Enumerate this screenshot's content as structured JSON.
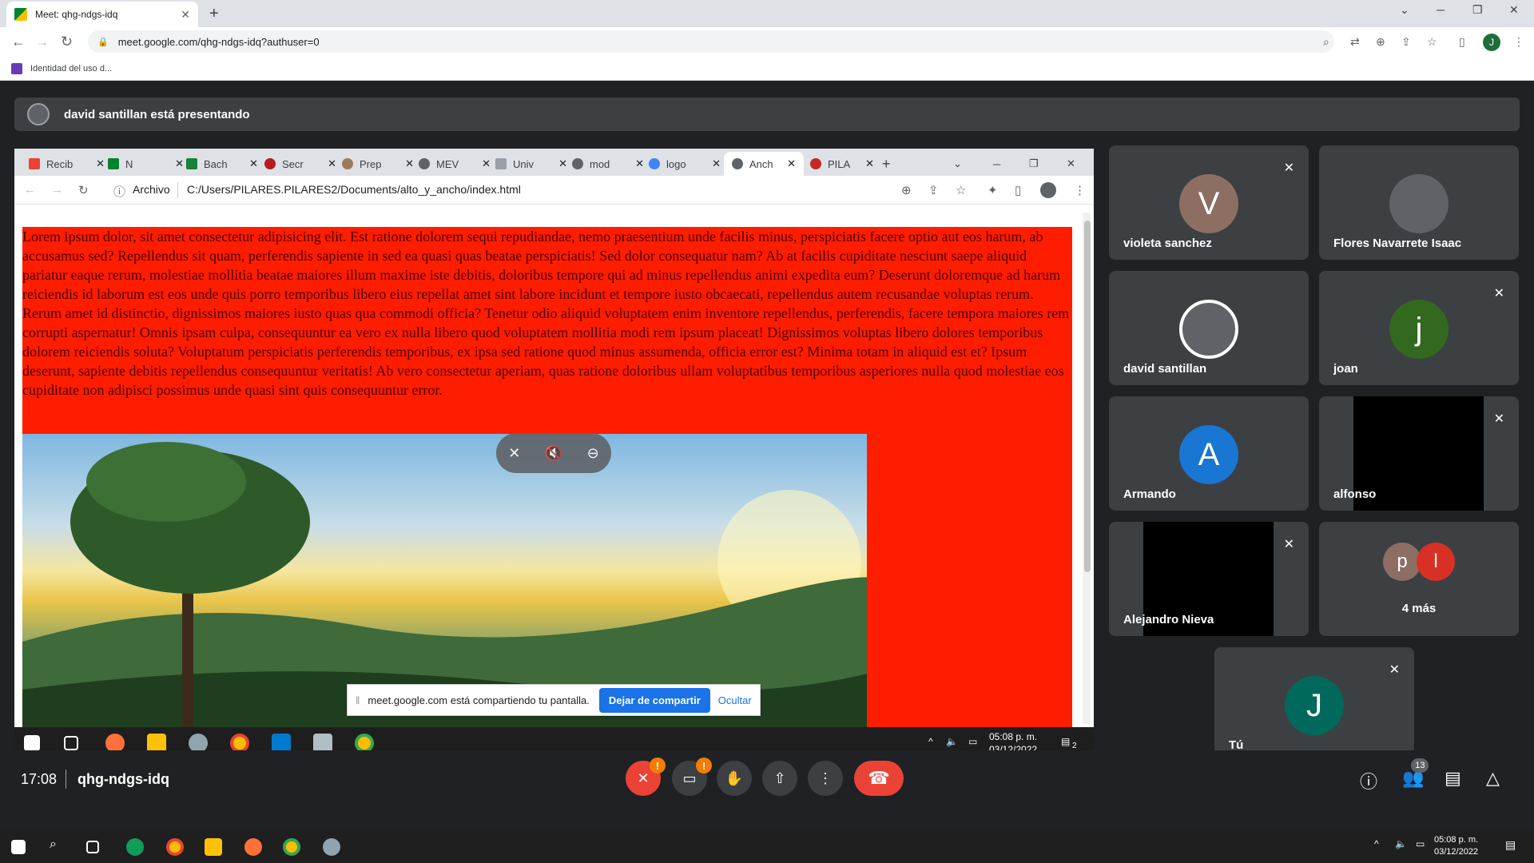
{
  "browser": {
    "tab_title": "Meet: qhg-ndgs-idq",
    "tab_close": "✕",
    "new_tab": "+",
    "url": "meet.google.com/qhg-ndgs-idq?authuser=0",
    "bookmark": "Identidad del uso d...",
    "profile_initial": "J"
  },
  "meet": {
    "presenting_text": "david santillan está presentando",
    "time": "17:08",
    "meeting_code": "qhg-ndgs-idq",
    "participants_count": "13",
    "end_call_icon": "phone-hangup-icon"
  },
  "shared_screen": {
    "tabs": [
      "Recib",
      "N",
      "Bach",
      "Secr",
      "Prep",
      "MEV",
      "Univ",
      "mod",
      "logo",
      "Anch",
      "PILA"
    ],
    "address_label": "Archivo",
    "address_path": "C:/Users/PILARES.PILARES2/Documents/alto_y_ancho/index.html",
    "lorem": "Lorem ipsum dolor, sit amet consectetur adipisicing elit. Est ratione dolorem sequi repudiandae, nemo praesentium unde facilis minus, perspiciatis facere optio aut eos harum, ab accusamus sed? Repellendus sit quam, perferendis sapiente in sed ea quasi quas beatae perspiciatis! Sed dolor consequatur nam? Ab at facilis cupiditate nesciunt saepe aliquid pariatur eaque rerum, molestiae mollitia beatae maiores illum maxime iste debitis, doloribus tempore qui ad minus repellendus animi expedita eum? Deserunt doloremque ad harum reiciendis id laborum est eos unde quis porro temporibus libero eius repellat amet sint labore incidunt et tempore iusto obcaecati, repellendus autem recusandae voluptas rerum. Rerum amet id distinctio, dignissimos maiores iusto quas qua commodi officia? Tenetur odio aliquid voluptatem enim inventore repellendus, perferendis, facere tempora maiores rem corrupti aspernatur! Omnis ipsam culpa, consequuntur ea vero ex nulla libero quod voluptatem mollitia modi rem ipsum placeat! Dignissimos voluptas libero dolores temporibus dolorem reiciendis soluta? Voluptatum perspiciatis perferendis temporibus, ex ipsa sed ratione quod minus assumenda, officia error est? Minima totam in aliquid est et? Ipsum deserunt, sapiente debitis repellendus consequuntur veritatis! Ab vero consectetur aperiam, quas ratione doloribus ullam voluptatibus temporibus asperiores nulla quod molestiae eos cupiditate non adipisci possimus unde quasi sint quis consequuntur error.",
    "share_notice": "meet.google.com está compartiendo tu pantalla.",
    "stop_share": "Dejar de compartir",
    "hide": "Ocultar",
    "taskbar_time": "05:08 p. m.",
    "taskbar_date": "03/12/2022",
    "notif_count": "2"
  },
  "participants": [
    {
      "name": "violeta sanchez",
      "initial": "V",
      "color": "#8d6e63",
      "muted": true
    },
    {
      "name": "Flores Navarrete Isaac",
      "initial": "",
      "color": "#5f6368",
      "muted": false
    },
    {
      "name": "david santillan",
      "initial": "",
      "color": "#5f6368",
      "muted": false
    },
    {
      "name": "joan",
      "initial": "j",
      "color": "#33691e",
      "muted": true
    },
    {
      "name": "Armando",
      "initial": "A",
      "color": "#1976d2",
      "muted": false
    },
    {
      "name": "alfonso",
      "initial": "",
      "color": "#000000",
      "muted": true
    },
    {
      "name": "Alejandro Nieva",
      "initial": "",
      "color": "#000000",
      "muted": true
    },
    {
      "name": "4 más",
      "initial": "p",
      "initial2": "l",
      "color": "#8d6e63",
      "color2": "#d93025",
      "muted": false
    },
    {
      "name": "Tú",
      "initial": "J",
      "color": "#00695c",
      "muted": true
    }
  ],
  "os": {
    "time": "05:08 p. m.",
    "date": "03/12/2022"
  }
}
